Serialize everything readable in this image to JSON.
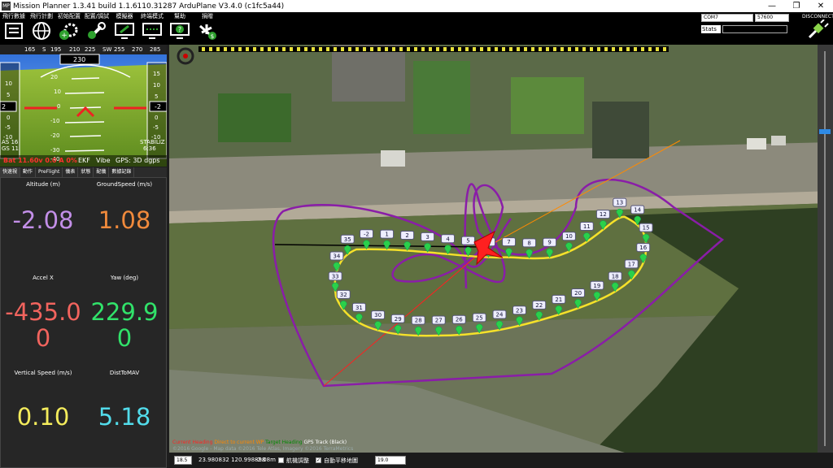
{
  "window": {
    "title": "Mission Planner 1.3.41 build 1.1.6110.31287 ArduPlane V3.4.0 (c1fc5a44)",
    "icon_text": "MP",
    "controls": [
      "—",
      "❐",
      "✕"
    ]
  },
  "menu": [
    {
      "label": "飛行數據",
      "icon": "flight-data-icon"
    },
    {
      "label": "飛行計劃",
      "icon": "globe-icon"
    },
    {
      "label": "初始配置",
      "icon": "gear-plus-icon"
    },
    {
      "label": "配置/調試",
      "icon": "wrench-icon"
    },
    {
      "label": "模擬器",
      "icon": "simulator-icon"
    },
    {
      "label": "終端模式",
      "icon": "terminal-icon"
    },
    {
      "label": "幫助",
      "icon": "help-icon"
    },
    {
      "label": "捐贈",
      "icon": "donate-icon"
    }
  ],
  "connection": {
    "port": "COM7",
    "baud": "57600",
    "stats_label": "Stats",
    "disconnect_label": "DISCONNECT"
  },
  "hud": {
    "heading_ticks": [
      "165",
      "S",
      "195",
      "210",
      "225",
      "SW",
      "255",
      "270",
      "285"
    ],
    "heading_value": "230",
    "airspeed": "2",
    "altitude": "-2",
    "as_text": "AS 16",
    "gs_text": "GS 11",
    "mode": "STABILIZ",
    "time": "6:36",
    "battery": "Bat 11.60v 0.0 A 0%",
    "ekf": "EKF",
    "vibe": "Vibe",
    "gps": "GPS: 3D dgps",
    "pitch_labels": [
      "20",
      "10",
      "0",
      "-10",
      "-20",
      "-30",
      "-40"
    ],
    "left_scale": [
      "10",
      "5",
      "0",
      "-5",
      "-10"
    ],
    "right_scale": [
      "15",
      "10",
      "5",
      "0",
      "-5",
      "-10"
    ]
  },
  "tabs": [
    "快速視",
    "動作",
    "PreFlight",
    "儀表",
    "狀態",
    "配儀",
    "數據記錄"
  ],
  "quick": [
    {
      "label": "Altitude (m)",
      "value": "-2.08",
      "color": "#c38fe8"
    },
    {
      "label": "GroundSpeed (m/s)",
      "value": "1.08",
      "color": "#f08a3c"
    },
    {
      "label": "Accel X",
      "value": "-435.0\n0",
      "color": "#f2645e"
    },
    {
      "label": "Yaw (deg)",
      "value": "229.9\n0",
      "color": "#31e26a"
    },
    {
      "label": "Vertical Speed (m/s)",
      "value": "0.10",
      "color": "#f4ec5c"
    },
    {
      "label": "DistToMAV",
      "value": "5.18",
      "color": "#52dceb"
    }
  ],
  "map": {
    "legend": [
      {
        "text": "Current Heading",
        "color": "#ff2222"
      },
      {
        "text": "Direct to current WP",
        "color": "#ff8800"
      },
      {
        "text": "Target Heading",
        "color": "#008800"
      },
      {
        "text": "GPS Track (Black)",
        "color": "#ffffff"
      }
    ],
    "copyright": "©2016 Google - Map data ©2016 Tele Atlas, Imagery ©2016 TerraMetrics",
    "waypoints": [
      {
        "n": "-2"
      },
      {
        "n": "1"
      },
      {
        "n": "2"
      },
      {
        "n": "3"
      },
      {
        "n": "4"
      },
      {
        "n": "5"
      },
      {
        "n": "6"
      },
      {
        "n": "7"
      },
      {
        "n": "8"
      },
      {
        "n": "9"
      },
      {
        "n": "10"
      },
      {
        "n": "11"
      },
      {
        "n": "12"
      },
      {
        "n": "13"
      },
      {
        "n": "14"
      },
      {
        "n": "15"
      },
      {
        "n": "16"
      },
      {
        "n": "17"
      },
      {
        "n": "18"
      },
      {
        "n": "19"
      },
      {
        "n": "20"
      },
      {
        "n": "21"
      },
      {
        "n": "22"
      },
      {
        "n": "23"
      },
      {
        "n": "24"
      },
      {
        "n": "25"
      },
      {
        "n": "26"
      },
      {
        "n": "27"
      },
      {
        "n": "28"
      },
      {
        "n": "29"
      },
      {
        "n": "30"
      },
      {
        "n": "31"
      },
      {
        "n": "32"
      },
      {
        "n": "33"
      },
      {
        "n": "34"
      },
      {
        "n": "35"
      }
    ]
  },
  "status": {
    "zoom_label": "18.5",
    "coords": "23.980832 120.998898",
    "alt": "-2.08m",
    "auto_pan_label": "航機調整",
    "center_label": "自動平移地圖",
    "zoom_input": "19.0"
  }
}
